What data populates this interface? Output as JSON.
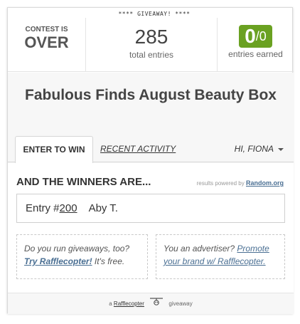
{
  "banner": "**** GIVEAWAY! ****",
  "stats": {
    "status_line1": "CONTEST IS",
    "status_line2": "OVER",
    "total_entries": "285",
    "total_label": "total entries",
    "earned_numerator": "0",
    "earned_denominator": "/0",
    "earned_label": "entries earned",
    "accent_color": "#6aa121"
  },
  "title": "Fabulous Finds August Beauty Box",
  "tabs": {
    "enter": "ENTER TO WIN",
    "recent": "RECENT ACTIVITY",
    "user": "HI, FIONA"
  },
  "winners": {
    "heading": "AND THE WINNERS ARE...",
    "powered_prefix": "results powered by",
    "powered_link": "Random.org",
    "entry_prefix": "Entry #",
    "entry_number": "200",
    "entry_name": "Aby T."
  },
  "promo_left": {
    "text": "Do you run giveaways, too?",
    "link": "Try Rafflecopter!",
    "suffix": " It's free."
  },
  "promo_right": {
    "text": "You an advertiser?",
    "link": "Promote your brand w/ Rafflecopter."
  },
  "footer": {
    "prefix": "a",
    "brand": "Rafflecopter",
    "suffix": "giveaway",
    "logo_icon": "rafflecopter-logo-icon"
  }
}
